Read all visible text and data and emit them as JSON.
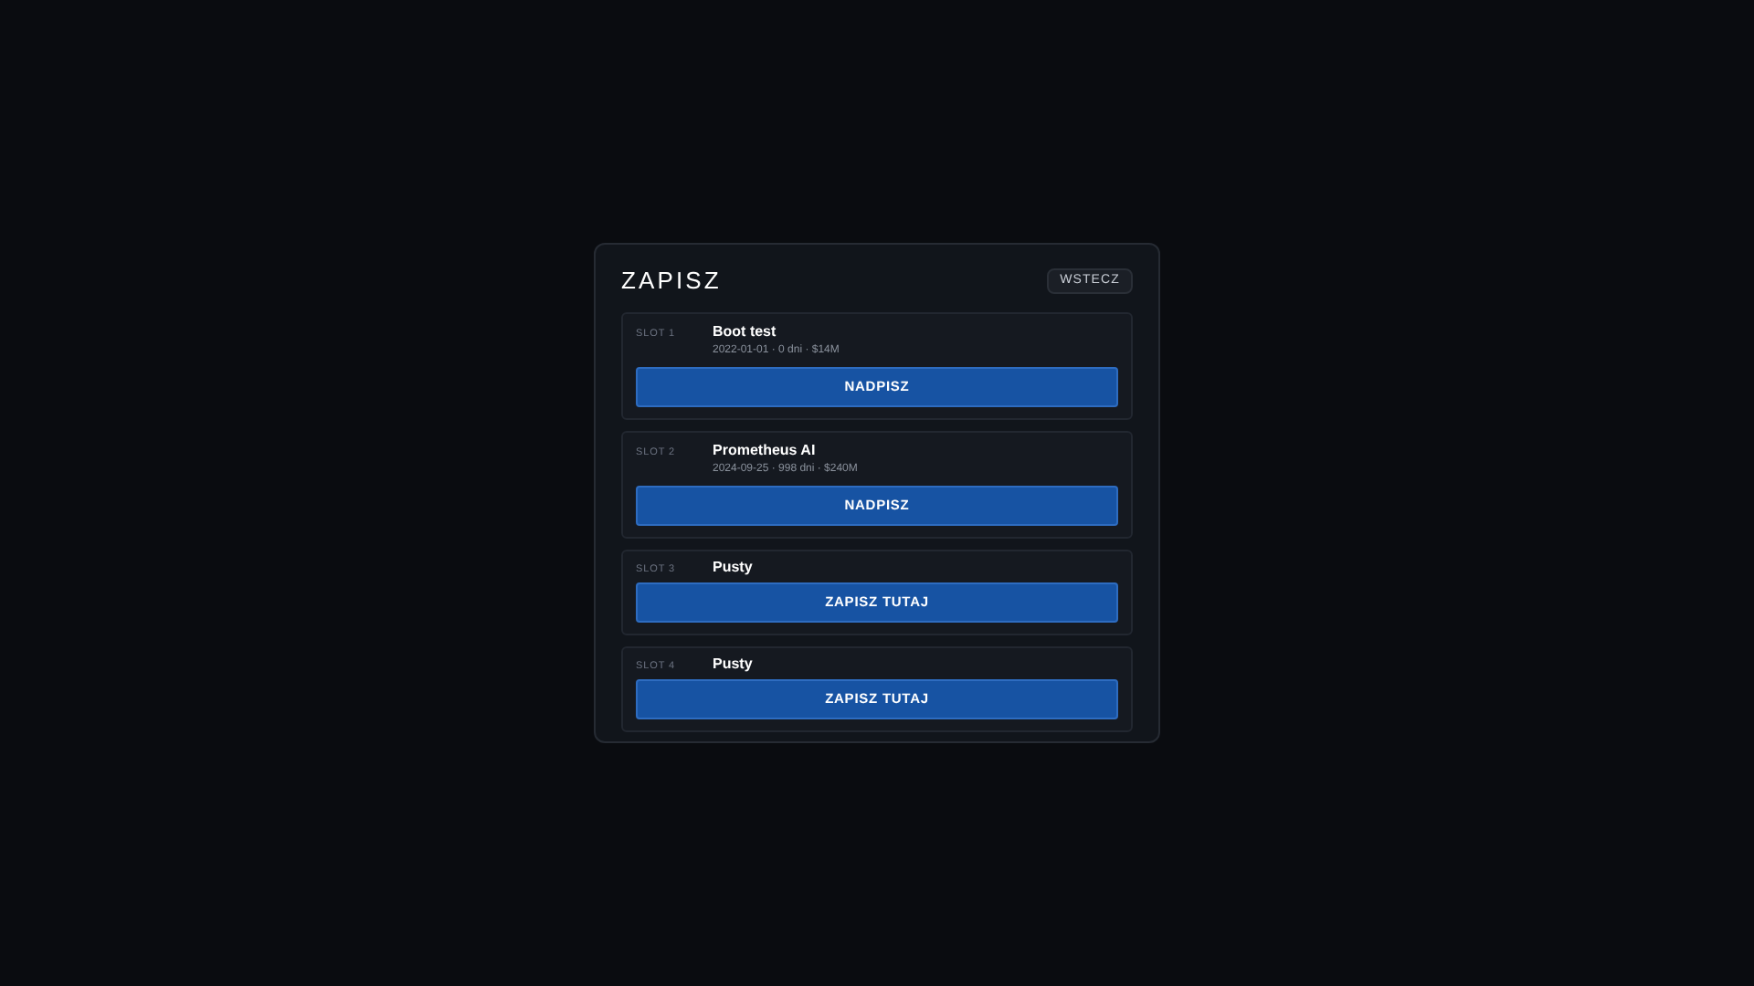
{
  "title": "ZAPISZ",
  "back_button": "WSTECZ",
  "slots": [
    {
      "kind": "filled",
      "label": "SLOT 1",
      "name": "Boot test",
      "meta": "2022-01-01 · 0 dni · $14M",
      "action": "NADPISZ"
    },
    {
      "kind": "filled",
      "label": "SLOT 2",
      "name": "Prometheus AI",
      "meta": "2024-09-25 · 998 dni · $240M",
      "action": "NADPISZ"
    },
    {
      "kind": "empty",
      "label": "SLOT 3",
      "name": "Pusty",
      "action": "ZAPISZ TUTAJ"
    },
    {
      "kind": "empty",
      "label": "SLOT 4",
      "name": "Pusty",
      "action": "ZAPISZ TUTAJ"
    }
  ]
}
